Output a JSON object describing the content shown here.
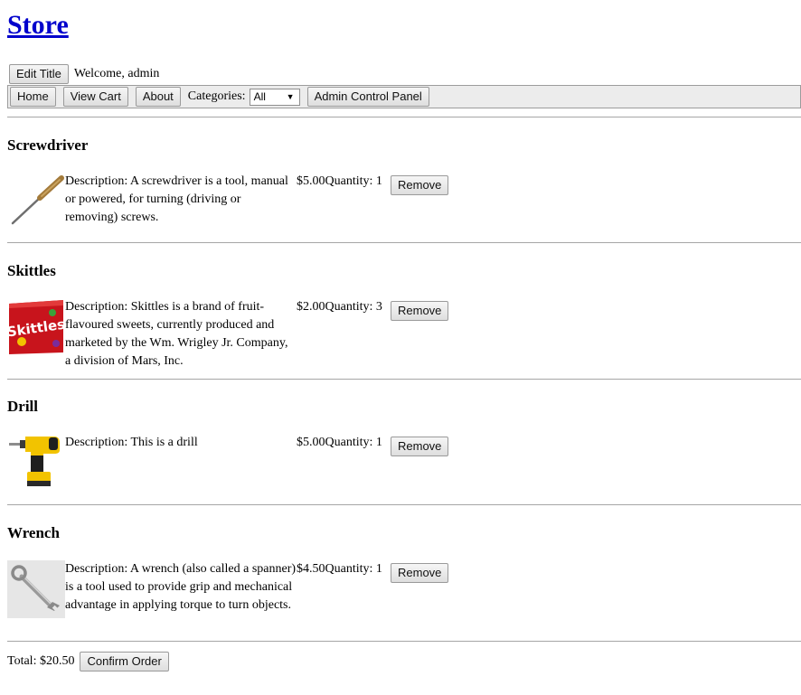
{
  "header": {
    "title": "Store",
    "edit_title_label": "Edit Title",
    "welcome": "Welcome, admin"
  },
  "nav": {
    "home": "Home",
    "view_cart": "View Cart",
    "about": "About",
    "categories_label": "Categories:",
    "category_selected": "All",
    "admin": "Admin Control Panel"
  },
  "cart": {
    "items": [
      {
        "name": "Screwdriver",
        "image_icon": "screwdriver-icon",
        "description": "Description: A screwdriver is a tool, manual or powered, for turning (driving or removing) screws.",
        "price": "$5.00",
        "quantity": "Quantity: 1",
        "remove_label": "Remove"
      },
      {
        "name": "Skittles",
        "image_icon": "skittles-bag-icon",
        "image_logo_text": "Skittles",
        "description": "Description: Skittles is a brand of fruit-flavoured sweets, currently produced and marketed by the Wm. Wrigley Jr. Company, a division of Mars, Inc.",
        "price": "$2.00",
        "quantity": "Quantity: 3",
        "remove_label": "Remove"
      },
      {
        "name": "Drill",
        "image_icon": "drill-icon",
        "description": "Description: This is a drill",
        "price": "$5.00",
        "quantity": "Quantity: 1",
        "remove_label": "Remove"
      },
      {
        "name": "Wrench",
        "image_icon": "wrench-icon",
        "description": "Description: A wrench (also called a spanner) is a tool used to provide grip and mechanical advantage in applying torque to turn objects.",
        "price": "$4.50",
        "quantity": "Quantity: 1",
        "remove_label": "Remove"
      }
    ],
    "total": "Total: $20.50",
    "confirm_label": "Confirm Order"
  }
}
